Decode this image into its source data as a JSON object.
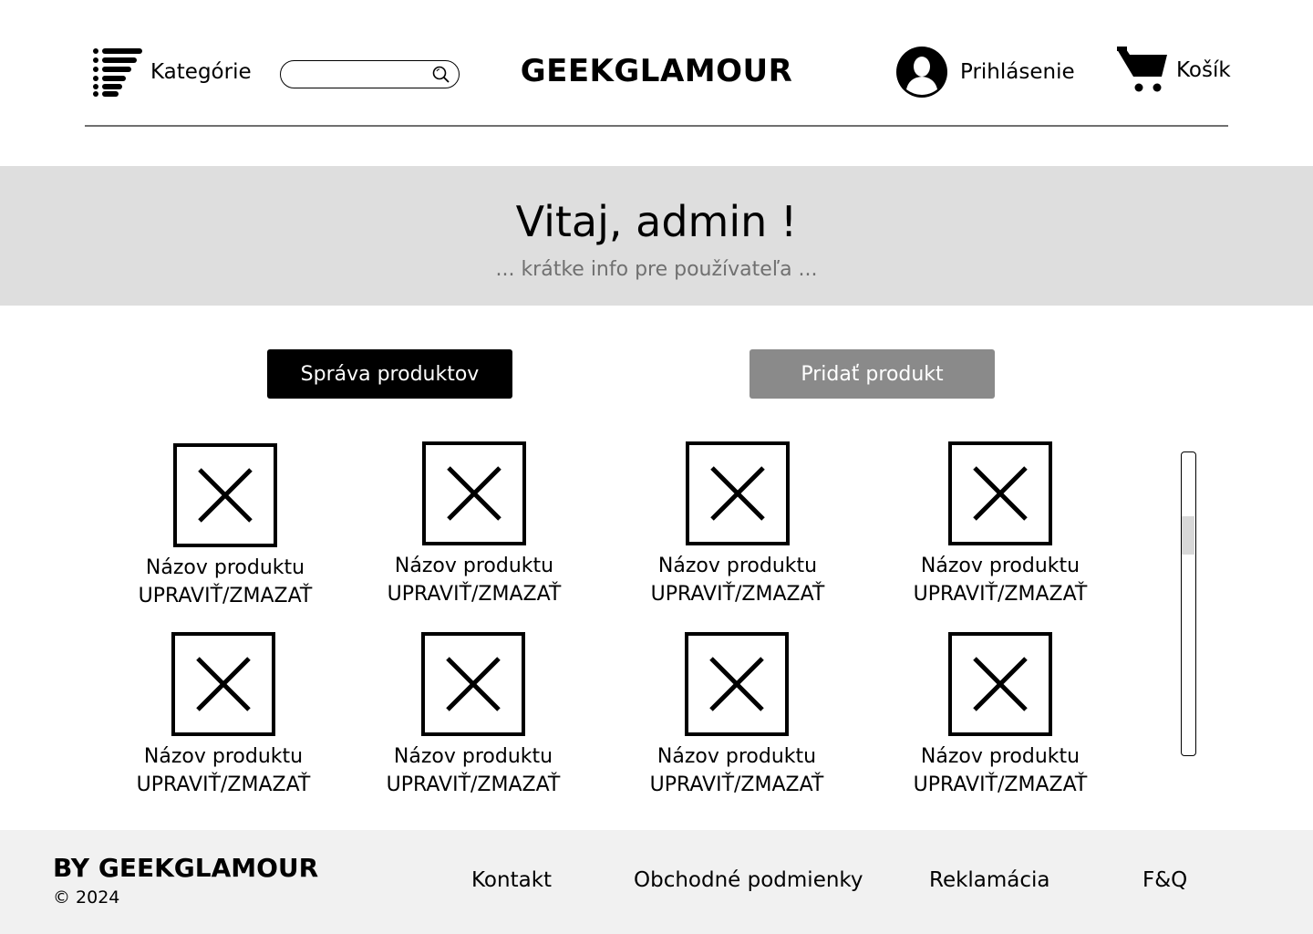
{
  "header": {
    "categories_label": "Kategórie",
    "search_placeholder": "",
    "logo": "GEEKGLAMOUR",
    "login_label": "Prihlásenie",
    "cart_label": "Košík"
  },
  "hero": {
    "title": "Vitaj, admin !",
    "subtitle": "... krátke info pre používateľa ..."
  },
  "actions": {
    "manage_label": "Správa produktov",
    "add_label": "Pridať produkt"
  },
  "products": [
    {
      "name": "Názov produktu",
      "actions": "UPRAVIŤ/ZMAZAŤ"
    },
    {
      "name": "Názov produktu",
      "actions": "UPRAVIŤ/ZMAZAŤ"
    },
    {
      "name": "Názov produktu",
      "actions": "UPRAVIŤ/ZMAZAŤ"
    },
    {
      "name": "Názov produktu",
      "actions": "UPRAVIŤ/ZMAZAŤ"
    },
    {
      "name": "Názov produktu",
      "actions": "UPRAVIŤ/ZMAZAŤ"
    },
    {
      "name": "Názov produktu",
      "actions": "UPRAVIŤ/ZMAZAŤ"
    },
    {
      "name": "Názov produktu",
      "actions": "UPRAVIŤ/ZMAZAŤ"
    },
    {
      "name": "Názov produktu",
      "actions": "UPRAVIŤ/ZMAZAŤ"
    }
  ],
  "footer": {
    "brand": "BY GEEKGLAMOUR",
    "copyright": "© 2024",
    "links": [
      "Kontakt",
      "Obchodné podmienky",
      "Reklamácia",
      "F&Q"
    ]
  },
  "colors": {
    "hero_background": "#dedede",
    "manage_button": "#000000",
    "add_button": "#8a8a8a",
    "footer_background": "#f1f1f1"
  }
}
